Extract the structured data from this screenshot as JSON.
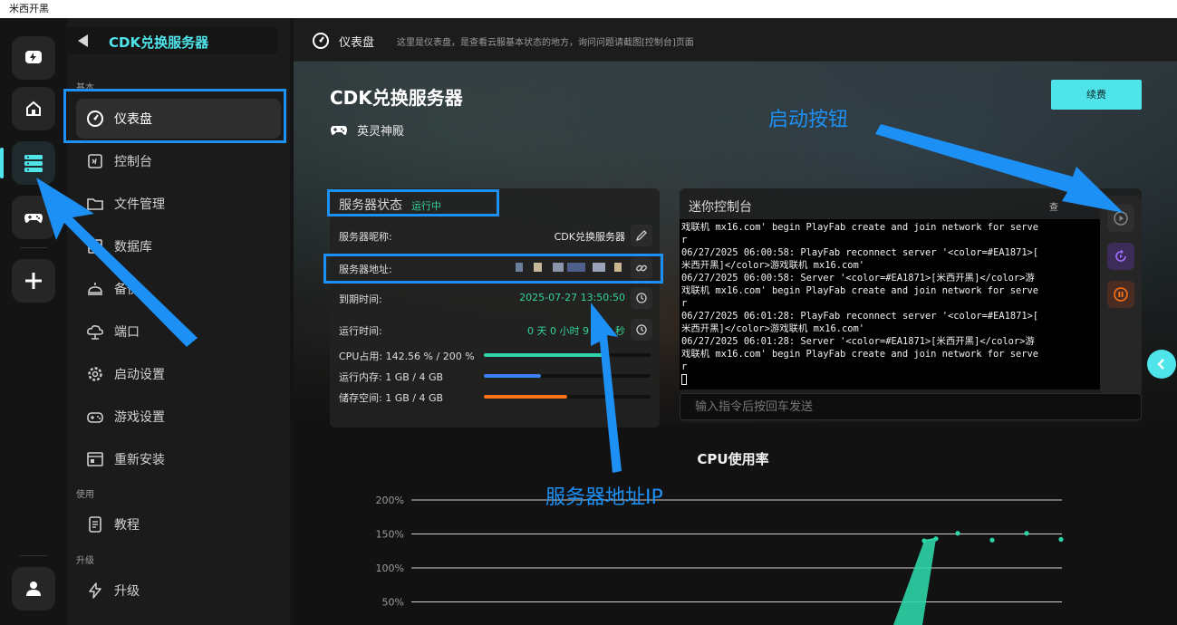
{
  "window": {
    "title": "米西开黑"
  },
  "sidebar": {
    "title": "CDK兑换服务器",
    "sections": {
      "basic": "基本",
      "use": "使用",
      "upgrade": "升级"
    },
    "items": [
      {
        "label": "仪表盘",
        "icon": "dashboard-icon"
      },
      {
        "label": "控制台",
        "icon": "terminal-icon"
      },
      {
        "label": "文件管理",
        "icon": "folder-icon"
      },
      {
        "label": "数据库",
        "icon": "database-icon"
      },
      {
        "label": "备份",
        "icon": "backup-icon"
      },
      {
        "label": "端口",
        "icon": "network-icon"
      },
      {
        "label": "启动设置",
        "icon": "gear-icon"
      },
      {
        "label": "游戏设置",
        "icon": "gamepad-icon"
      },
      {
        "label": "重新安装",
        "icon": "reinstall-icon"
      },
      {
        "label": "教程",
        "icon": "document-icon"
      },
      {
        "label": "升级",
        "icon": "lightning-icon"
      }
    ]
  },
  "topbar": {
    "title": "仪表盘",
    "hint": "这里是仪表盘，是查看云服基本状态的地方，询问问题请截图[控制台]页面"
  },
  "header": {
    "server_name": "CDK兑换服务器",
    "game_name": "英灵神殿",
    "renew_label": "续费"
  },
  "status": {
    "title": "服务器状态",
    "state": "运行中",
    "nickname_label": "服务器昵称:",
    "nickname_value": "CDK兑换服务器",
    "address_label": "服务器地址:",
    "expire_label": "到期时间:",
    "expire_value": "2025-07-27 13:50:50",
    "uptime_label": "运行时间:",
    "uptime_value": "0 天 0 小时 9 分钟 秒",
    "cpu_label": "CPU占用: 142.56 % / 200 %",
    "cpu_fraction": 0.7128,
    "mem_label": "运行内存: 1 GB / 4 GB",
    "mem_fraction": 0.34,
    "disk_label": "储存空间: 1 GB / 4 GB",
    "disk_fraction": 0.5,
    "colors": {
      "running": "#34d399",
      "cpu": "#2dd4a7",
      "mem": "#3b82f6",
      "disk": "#f97316"
    }
  },
  "console": {
    "title": "迷你控制台",
    "more": "查",
    "lines": [
      "戏联机 mx16.com' begin PlayFab create and join network for serve",
      "r",
      "06/27/2025 06:00:58: PlayFab reconnect server '<color=#EA1871>[",
      "米西开黑]</color>游戏联机 mx16.com'",
      "06/27/2025 06:00:58: Server '<color=#EA1871>[米西开黑]</color>游",
      "戏联机 mx16.com' begin PlayFab create and join network for serve",
      "r",
      "06/27/2025 06:01:28: PlayFab reconnect server '<color=#EA1871>[",
      "米西开黑]</color>游戏联机 mx16.com'",
      "06/27/2025 06:01:28: Server '<color=#EA1871>[米西开黑]</color>游",
      "戏联机 mx16.com' begin PlayFab create and join network for serve",
      "r"
    ],
    "input_placeholder": "输入指令后按回车发送"
  },
  "annotations": {
    "start_button": "启动按钮",
    "server_ip": "服务器地址IP"
  },
  "chart_data": {
    "type": "line",
    "title": "CPU使用率",
    "ylim": [
      0,
      200
    ],
    "yticks": [
      "200%",
      "150%",
      "100%",
      "50%"
    ],
    "ytick_values": [
      200,
      150,
      100,
      50
    ],
    "series": [
      {
        "values": [
          140,
          143,
          151,
          141,
          151,
          142
        ]
      }
    ],
    "colors": {
      "line": "#2dd4a7"
    }
  }
}
